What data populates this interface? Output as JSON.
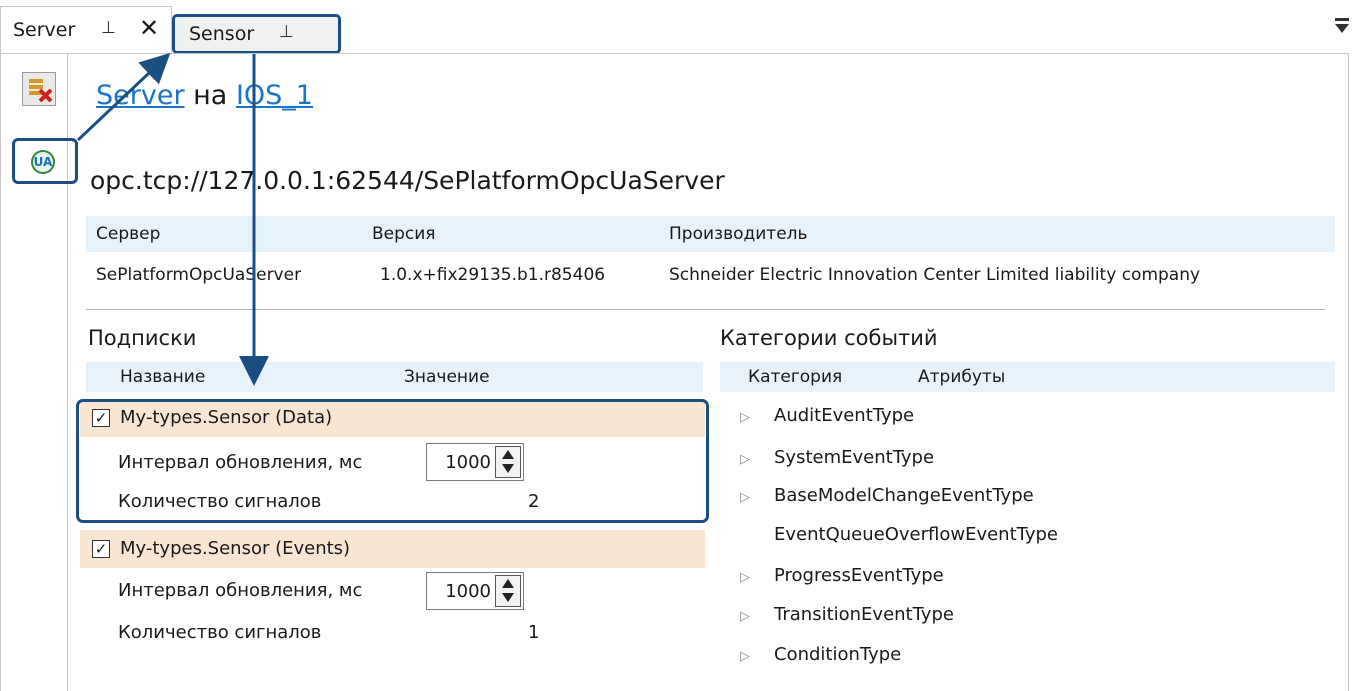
{
  "tabs": {
    "server": {
      "label": "Server",
      "pin": "⊥",
      "close": "✕"
    },
    "sensor": {
      "label": "Sensor",
      "pin": "⊥"
    }
  },
  "header": {
    "server_link": "Server",
    "on_text": "на",
    "ios_link": "IOS_1",
    "endpoint": "opc.tcp://127.0.0.1:62544/SePlatformOpcUaServer"
  },
  "server_table": {
    "columns": [
      "Сервер",
      "Версия",
      "Производитель"
    ],
    "row": [
      "SePlatformOpcUaServer",
      "1.0.x+fix29135.b1.r85406",
      "Schneider Electric Innovation Center Limited liability company"
    ]
  },
  "subscriptions": {
    "title": "Подписки",
    "columns": [
      "Название",
      "Значение"
    ],
    "groups": [
      {
        "name": "My-types.Sensor (Data)",
        "checked": true,
        "interval_label": "Интервал обновления, мс",
        "interval_value": "1000",
        "count_label": "Количество сигналов",
        "count_value": "2"
      },
      {
        "name": "My-types.Sensor (Events)",
        "checked": true,
        "interval_label": "Интервал обновления, мс",
        "interval_value": "1000",
        "count_label": "Количество сигналов",
        "count_value": "1"
      }
    ]
  },
  "event_categories": {
    "title": "Категории событий",
    "columns": [
      "Категория",
      "Атрибуты"
    ],
    "items": [
      {
        "label": "AuditEventType",
        "expandable": true
      },
      {
        "label": "SystemEventType",
        "expandable": true
      },
      {
        "label": "BaseModelChangeEventType",
        "expandable": true
      },
      {
        "label": "EventQueueOverflowEventType",
        "expandable": false
      },
      {
        "label": "ProgressEventType",
        "expandable": true
      },
      {
        "label": "TransitionEventType",
        "expandable": true
      },
      {
        "label": "ConditionType",
        "expandable": true
      }
    ]
  },
  "colors": {
    "accent": "#1b4f82",
    "link": "#1a74c9",
    "header_bg": "#e8f2fb",
    "group_bg": "#f9e6d2"
  }
}
